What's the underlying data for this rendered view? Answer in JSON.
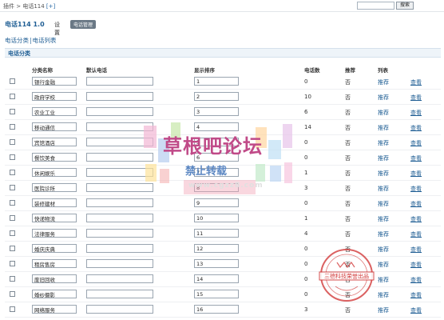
{
  "breadcrumb": {
    "text": "插件 > 电话114",
    "expand": "[+]"
  },
  "search": {
    "placeholder": "",
    "button": "搜索"
  },
  "plugin": {
    "title": "电话114 1.0",
    "nav_settings": "设置",
    "nav_manage": "电话管理"
  },
  "subtabs": {
    "category": "电话分类",
    "sep": "|",
    "list": "电话列表"
  },
  "section": {
    "title": "电话分类"
  },
  "columns": {
    "name": "分类名称",
    "default_phone": "默认电话",
    "order": "显示排序",
    "count": "电话数",
    "recommend": "推荐",
    "list": "列表"
  },
  "rows": [
    {
      "name": "银行金融",
      "phone": "",
      "order": "1",
      "count": "0",
      "rec": "否",
      "list": "推荐",
      "view": "查看"
    },
    {
      "name": "政府学校",
      "phone": "",
      "order": "2",
      "count": "10",
      "rec": "否",
      "list": "推荐",
      "view": "查看"
    },
    {
      "name": "农业工业",
      "phone": "",
      "order": "3",
      "count": "6",
      "rec": "否",
      "list": "推荐",
      "view": "查看"
    },
    {
      "name": "移动通信",
      "phone": "",
      "order": "4",
      "count": "14",
      "rec": "否",
      "list": "推荐",
      "view": "查看"
    },
    {
      "name": "宾馆酒店",
      "phone": "",
      "order": "5",
      "count": "0",
      "rec": "否",
      "list": "推荐",
      "view": "查看"
    },
    {
      "name": "餐饮美食",
      "phone": "",
      "order": "6",
      "count": "0",
      "rec": "否",
      "list": "推荐",
      "view": "查看"
    },
    {
      "name": "休闲娱乐",
      "phone": "",
      "order": "7",
      "count": "1",
      "rec": "否",
      "list": "推荐",
      "view": "查看"
    },
    {
      "name": "医院诊所",
      "phone": "",
      "order": "8",
      "count": "3",
      "rec": "否",
      "list": "推荐",
      "view": "查看"
    },
    {
      "name": "装修建材",
      "phone": "",
      "order": "9",
      "count": "0",
      "rec": "否",
      "list": "推荐",
      "view": "查看"
    },
    {
      "name": "快递物流",
      "phone": "",
      "order": "10",
      "count": "1",
      "rec": "否",
      "list": "推荐",
      "view": "查看"
    },
    {
      "name": "法律服务",
      "phone": "",
      "order": "11",
      "count": "4",
      "rec": "否",
      "list": "推荐",
      "view": "查看"
    },
    {
      "name": "婚庆庆典",
      "phone": "",
      "order": "12",
      "count": "0",
      "rec": "否",
      "list": "推荐",
      "view": "查看"
    },
    {
      "name": "租房售房",
      "phone": "",
      "order": "13",
      "count": "0",
      "rec": "否",
      "list": "推荐",
      "view": "查看"
    },
    {
      "name": "废旧回收",
      "phone": "",
      "order": "14",
      "count": "0",
      "rec": "否",
      "list": "推荐",
      "view": "查看"
    },
    {
      "name": "婚纱摄影",
      "phone": "",
      "order": "15",
      "count": "0",
      "rec": "否",
      "list": "推荐",
      "view": "查看"
    },
    {
      "name": "网络服务",
      "phone": "",
      "order": "16",
      "count": "3",
      "rec": "否",
      "list": "推荐",
      "view": "查看"
    }
  ],
  "watermark": {
    "title": "草根吧论坛",
    "sub": "禁止转载",
    "url": "www.cgzz8.com"
  },
  "stamp": {
    "text": "三德科技荣誉出品"
  },
  "colors": {
    "link": "#1f5e94",
    "section_bg": "#eef4f9",
    "nav_active_bg": "#6a7885"
  }
}
